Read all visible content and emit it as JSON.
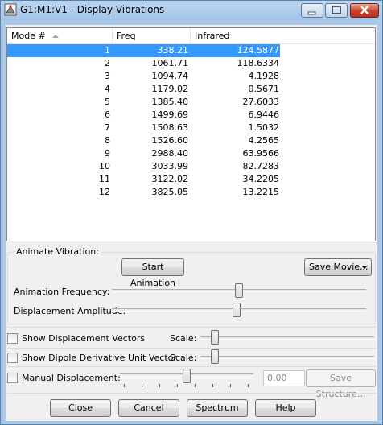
{
  "window": {
    "title": "G1:M1:V1 - Display Vibrations"
  },
  "table": {
    "columns": [
      "Mode #",
      "Freq",
      "Infrared"
    ],
    "rows": [
      {
        "mode": "1",
        "freq": "338.21",
        "ir": "124.5877",
        "selected": true
      },
      {
        "mode": "2",
        "freq": "1061.71",
        "ir": "118.6334"
      },
      {
        "mode": "3",
        "freq": "1094.74",
        "ir": "4.1928"
      },
      {
        "mode": "4",
        "freq": "1179.02",
        "ir": "0.5671"
      },
      {
        "mode": "5",
        "freq": "1385.40",
        "ir": "27.6033"
      },
      {
        "mode": "6",
        "freq": "1499.69",
        "ir": "6.9446"
      },
      {
        "mode": "7",
        "freq": "1508.63",
        "ir": "1.5032"
      },
      {
        "mode": "8",
        "freq": "1526.60",
        "ir": "4.2565"
      },
      {
        "mode": "9",
        "freq": "2988.40",
        "ir": "63.9566"
      },
      {
        "mode": "10",
        "freq": "3033.99",
        "ir": "82.7283"
      },
      {
        "mode": "11",
        "freq": "3122.02",
        "ir": "34.2205"
      },
      {
        "mode": "12",
        "freq": "3825.05",
        "ir": "13.2215"
      }
    ]
  },
  "animate": {
    "group_title": "Animate Vibration:",
    "start_button": "Start Animation",
    "save_movie_button": "Save Movie...",
    "frequency_label": "Animation Frequency:",
    "amplitude_label": "Displacement Amplitude:",
    "frequency_level": 0.5,
    "amplitude_level": 0.49
  },
  "options": {
    "displacement_vectors_label": "Show Displacement Vectors",
    "dipole_vector_label": "Show Dipole Derivative Unit Vector",
    "scale_label": "Scale:",
    "displacement_vectors_checked": false,
    "dipole_vector_checked": false
  },
  "manual": {
    "label": "Manual Displacement:",
    "value": "0.00",
    "save_structure_button": "Save Structure...",
    "checked": false
  },
  "buttons": {
    "close": "Close",
    "cancel": "Cancel",
    "spectrum": "Spectrum",
    "help": "Help"
  },
  "colors": {
    "selection": "#3399ff",
    "title_bar": "#a9c8ea",
    "close_button": "#c4442e"
  }
}
